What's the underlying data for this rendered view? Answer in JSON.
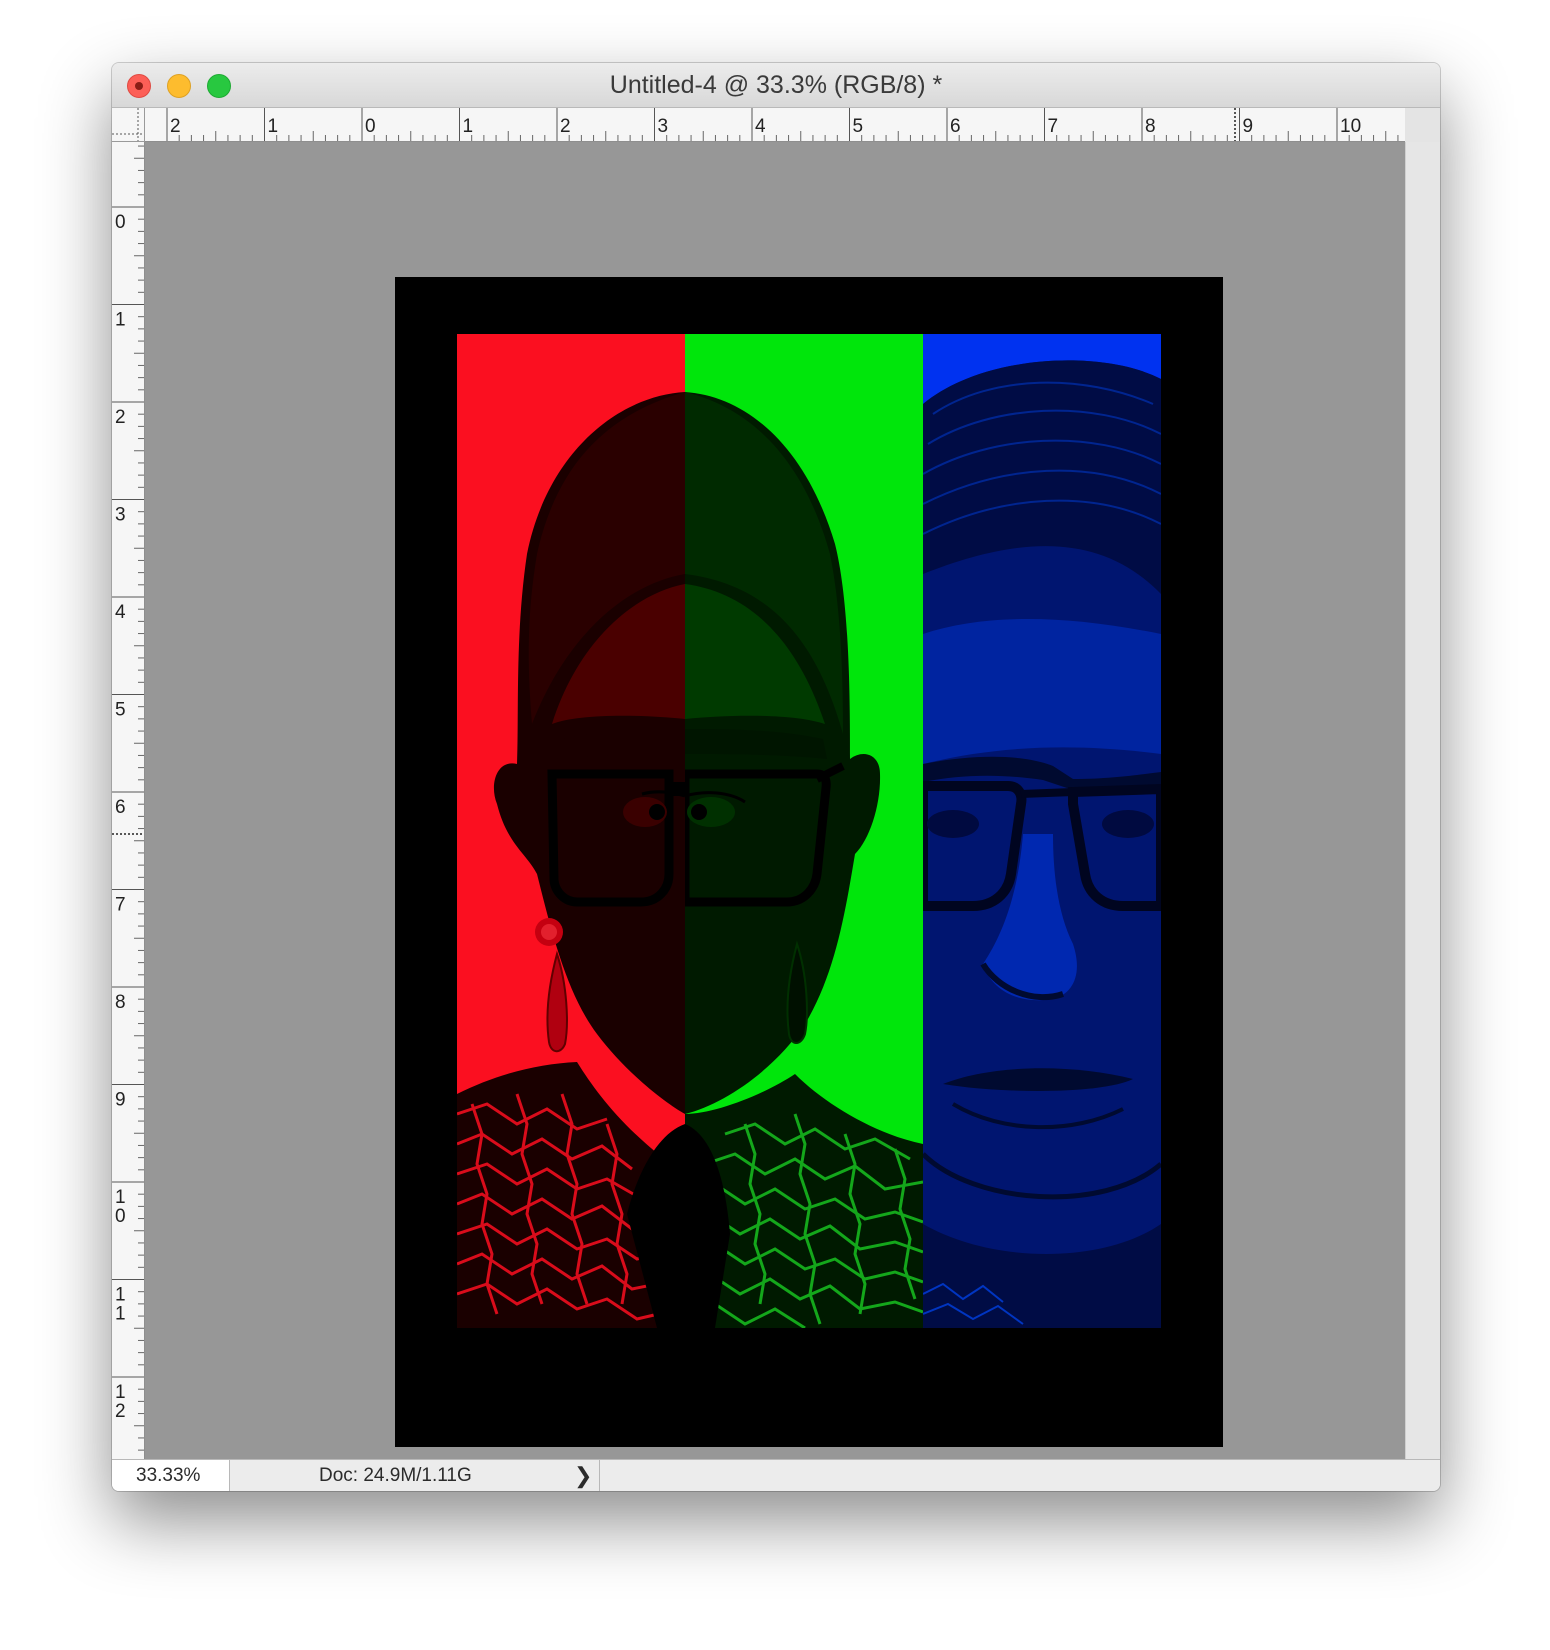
{
  "window": {
    "title": "Untitled-4 @ 33.3% (RGB/8) *"
  },
  "rulers": {
    "horizontal_labels": [
      "2",
      "1",
      "0",
      "1",
      "2",
      "3",
      "4",
      "5",
      "6",
      "7",
      "8",
      "9",
      "10"
    ],
    "vertical_labels": [
      "0",
      "1",
      "2",
      "3",
      "4",
      "5",
      "6",
      "7",
      "8",
      "9",
      "10",
      "11",
      "12"
    ]
  },
  "document": {
    "background_color": "#000000",
    "strip_colors": [
      "#fb0f20",
      "#00e60b",
      "#0032f0"
    ]
  },
  "status": {
    "zoom": "33.33%",
    "doc_info": "Doc: 24.9M/1.11G",
    "arrow": "❯"
  }
}
